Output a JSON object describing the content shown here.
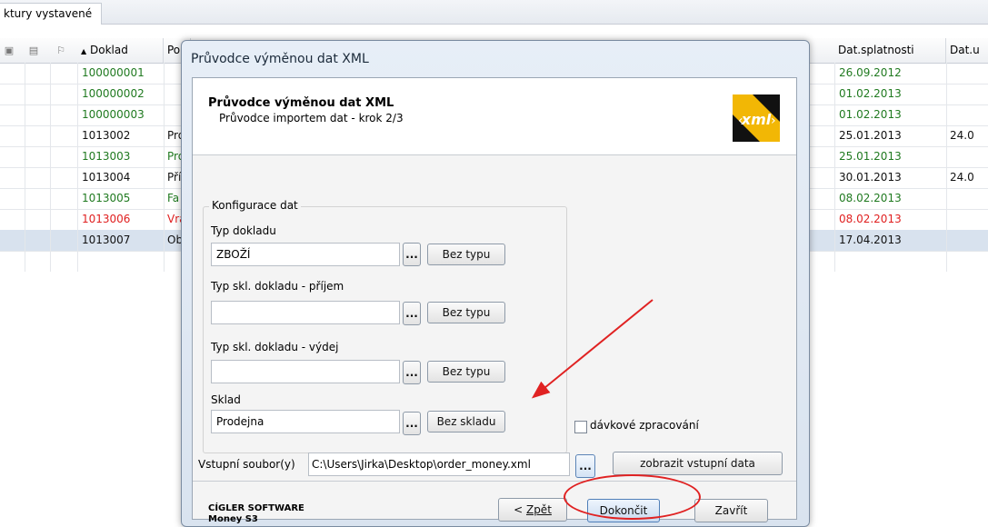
{
  "background": {
    "tab_label": "ktury vystavené",
    "columns": {
      "doklad": "Doklad",
      "po": "Po",
      "dat_splatnosti": "Dat.splatnosti",
      "dat_u": "Dat.u"
    },
    "rows": [
      {
        "doklad": "100000001",
        "po": "",
        "splatnost": "26.09.2012",
        "dat_u": "",
        "color": "green",
        "selected": false
      },
      {
        "doklad": "100000002",
        "po": "",
        "splatnost": "01.02.2013",
        "dat_u": "",
        "color": "green",
        "selected": false
      },
      {
        "doklad": "100000003",
        "po": "",
        "splatnost": "01.02.2013",
        "dat_u": "",
        "color": "green",
        "selected": false
      },
      {
        "doklad": "1013002",
        "po": "Pro",
        "splatnost": "25.01.2013",
        "dat_u": "24.0",
        "color": "black",
        "selected": false
      },
      {
        "doklad": "1013003",
        "po": "Pro",
        "splatnost": "25.01.2013",
        "dat_u": "",
        "color": "green",
        "selected": false
      },
      {
        "doklad": "1013004",
        "po": "Pří",
        "splatnost": "30.01.2013",
        "dat_u": "24.0",
        "color": "black",
        "selected": false
      },
      {
        "doklad": "1013005",
        "po": "Fa",
        "splatnost": "08.02.2013",
        "dat_u": "",
        "color": "green",
        "selected": false
      },
      {
        "doklad": "1013006",
        "po": "Vra",
        "splatnost": "08.02.2013",
        "dat_u": "",
        "color": "red",
        "selected": false
      },
      {
        "doklad": "1013007",
        "po": "Ob",
        "splatnost": "17.04.2013",
        "dat_u": "",
        "color": "black",
        "selected": true
      }
    ]
  },
  "dialog": {
    "title": "Průvodce výměnou dat XML",
    "header_title": "Průvodce výměnou dat XML",
    "header_subtitle": "Průvodce importem dat - krok 2/3",
    "logo_text": "xml",
    "group_label": "Konfigurace dat",
    "fields": {
      "typ_dokladu": {
        "label": "Typ dokladu",
        "value": "ZBOŽÍ",
        "button": "Bez typu"
      },
      "typ_prijem": {
        "label": "Typ skl. dokladu - příjem",
        "value": "",
        "button": "Bez typu"
      },
      "typ_vydej": {
        "label": "Typ skl. dokladu - výdej",
        "value": "",
        "button": "Bez typu"
      },
      "sklad": {
        "label": "Sklad",
        "value": "Prodejna",
        "button": "Bez skladu"
      }
    },
    "browse_label": "...",
    "batch_checkbox": {
      "label": "dávkové zpracování",
      "checked": false
    },
    "input_file": {
      "label": "Vstupní soubor(y)",
      "value": "C:\\Users\\Jirka\\Desktop\\order_money.xml"
    },
    "show_data_button": "zobrazit vstupní data",
    "brand_line1": "CÍGLER SOFTWARE",
    "brand_line2": "Money S3",
    "buttons": {
      "back": "< Zpět",
      "finish": "Dokončit",
      "close": "Zavřít"
    }
  },
  "annotation_color": "#e02222"
}
